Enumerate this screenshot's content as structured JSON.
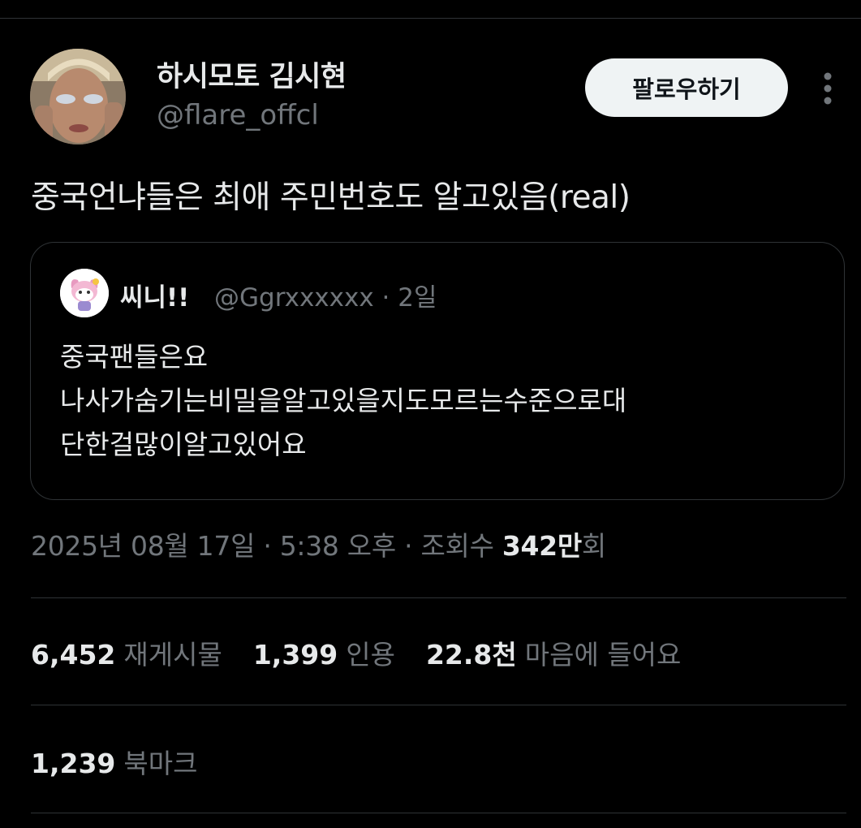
{
  "author": {
    "display_name": "하시모토 김시현",
    "handle": "@flare_offcl"
  },
  "follow_button": {
    "label": "팔로우하기"
  },
  "tweet_text": "중국언냐들은 최애 주민번호도 알고있음(real)",
  "quoted_tweet": {
    "display_name": "씨니!!",
    "handle_and_time": "@Ggrxxxxxx · 2일",
    "lines": [
      "중국팬들은요",
      "나사가숨기는비밀을알고있을지도모르는수준으로대",
      "단한걸많이알고있어요"
    ]
  },
  "meta": {
    "timestamp": "2025년 08월 17일 · 5:38 오후 · 조회수 ",
    "views_number": "342",
    "views_unit_bold": "만",
    "views_unit_suffix": "회"
  },
  "stats": {
    "reposts": {
      "count": "6,452",
      "label": "재게시물"
    },
    "quotes": {
      "count": "1,399",
      "label": "인용"
    },
    "likes": {
      "count": "22.8천",
      "label": "마음에 들어요"
    },
    "bookmarks": {
      "count": "1,239",
      "label": "북마크"
    }
  },
  "icons": {
    "more": "more-vertical-icon"
  },
  "colors": {
    "background": "#000000",
    "text_primary": "#e7e9ea",
    "text_secondary": "#71767b",
    "border": "#2f3336",
    "follow_button_bg": "#eff3f4"
  }
}
